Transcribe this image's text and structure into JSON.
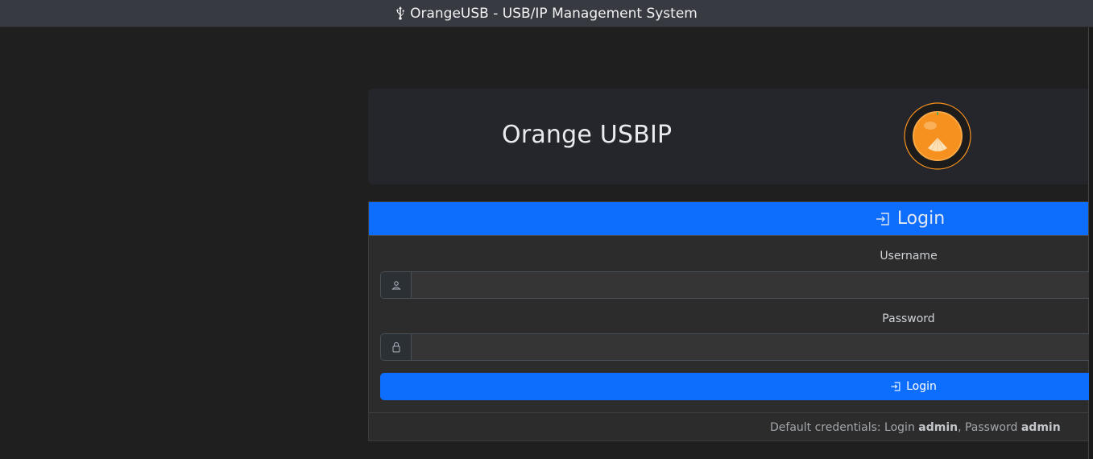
{
  "window": {
    "title": "OrangeUSB - USB/IP Management System",
    "icon": "usb-icon"
  },
  "header": {
    "title": "Orange USBIP",
    "logo": "orange-logo"
  },
  "login": {
    "heading": "Login",
    "heading_icon": "enter-icon",
    "username_label": "Username",
    "username_value": "",
    "username_icon": "person-icon",
    "password_label": "Password",
    "password_value": "",
    "password_icon": "lock-icon",
    "submit_label": "Login",
    "footer": {
      "prefix": "Default credentials: Login ",
      "login_value": "admin",
      "middle": ", Password ",
      "password_value": "admin"
    }
  },
  "colors": {
    "primary": "#0d6efd",
    "background": "#1f1f1f",
    "card": "#24262b",
    "orange": "#f6901e"
  }
}
